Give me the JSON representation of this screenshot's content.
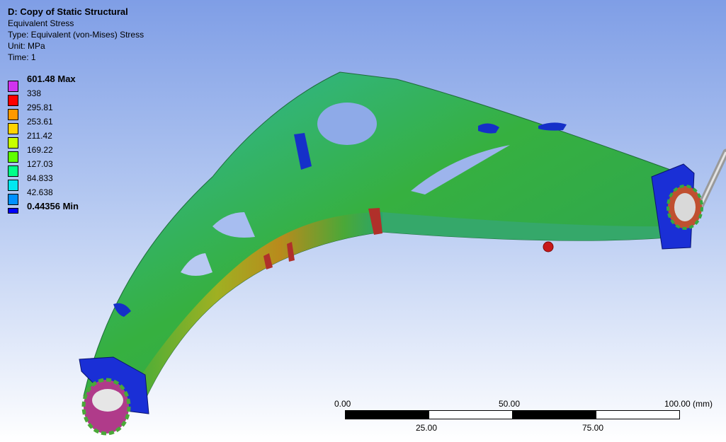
{
  "result": {
    "title": "D: Copy of Static Structural",
    "name": "Equivalent Stress",
    "type": "Type: Equivalent (von-Mises) Stress",
    "unit": "Unit: MPa",
    "time": "Time: 1"
  },
  "legend": {
    "entries": [
      {
        "label": "601.48 Max",
        "color": "#d033f0",
        "bold": true
      },
      {
        "label": "338",
        "color": "#ff0000"
      },
      {
        "label": "295.81",
        "color": "#ff9900"
      },
      {
        "label": "253.61",
        "color": "#ffd400"
      },
      {
        "label": "211.42",
        "color": "#c8ff00"
      },
      {
        "label": "169.22",
        "color": "#5fff00"
      },
      {
        "label": "127.03",
        "color": "#00ff8a"
      },
      {
        "label": "84.833",
        "color": "#00e7f0"
      },
      {
        "label": "42.638",
        "color": "#0090ff"
      },
      {
        "label": "0.44356 Min",
        "color": "#0000ff",
        "bold": true
      }
    ]
  },
  "scale_bar": {
    "top_labels": [
      "0.00",
      "50.00",
      "100.00 (mm)"
    ],
    "bottom_labels": [
      "25.00",
      "75.00"
    ]
  },
  "colors": {
    "background_top": "#7f9ee6",
    "background_bottom": "#ffffff",
    "mesh_green": "#36b040",
    "mesh_teal": "#2fb8a6",
    "hot_red": "#b0302a"
  }
}
